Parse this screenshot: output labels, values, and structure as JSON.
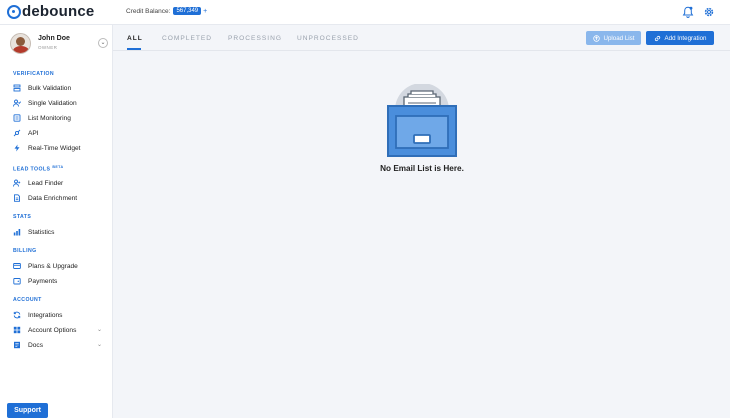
{
  "app": {
    "logo_text": "debounce",
    "brand_color": "#1f6fd6"
  },
  "header": {
    "credit_label": "Credit Balance:",
    "credit_value": "567,349",
    "credit_plus": "+",
    "icons": [
      "bell-icon",
      "gear-icon"
    ]
  },
  "user": {
    "name": "John Doe",
    "role": "OWNER",
    "toggle": "⌄"
  },
  "sidebar": {
    "sections": {
      "verification": "VERIFICATION",
      "lead_tools": "LEAD TOOLS",
      "lead_tools_badge": "BETA",
      "stats": "STATS",
      "billing": "BILLING",
      "account": "ACCOUNT"
    },
    "items": [
      {
        "label": "Bulk Validation",
        "icon": "stack-icon"
      },
      {
        "label": "Single Validation",
        "icon": "user-check-icon"
      },
      {
        "label": "List Monitoring",
        "icon": "list-icon"
      },
      {
        "label": "API",
        "icon": "api-icon"
      },
      {
        "label": "Real-Time Widget",
        "icon": "bolt-icon"
      },
      {
        "label": "Lead Finder",
        "icon": "user-plus-icon"
      },
      {
        "label": "Data Enrichment",
        "icon": "document-icon"
      },
      {
        "label": "Statistics",
        "icon": "chart-icon"
      },
      {
        "label": "Plans & Upgrade",
        "icon": "card-icon"
      },
      {
        "label": "Payments",
        "icon": "wallet-icon"
      },
      {
        "label": "Integrations",
        "icon": "sync-icon"
      },
      {
        "label": "Account Options",
        "icon": "grid-icon",
        "has_chevron": true
      },
      {
        "label": "Docs",
        "icon": "folder-icon",
        "has_chevron": true
      }
    ],
    "chevron": "⌄",
    "support_label": "Support"
  },
  "main": {
    "tabs": [
      {
        "label": "ALL",
        "active": true
      },
      {
        "label": "COMPLETED",
        "active": false
      },
      {
        "label": "PROCESSING",
        "active": false
      },
      {
        "label": "UNPROCESSED",
        "active": false
      }
    ],
    "upload_label": "Upload List",
    "add_integration_label": "Add Integration",
    "empty_message": "No Email List is Here.",
    "empty_icon": "file-drawer-icon"
  }
}
